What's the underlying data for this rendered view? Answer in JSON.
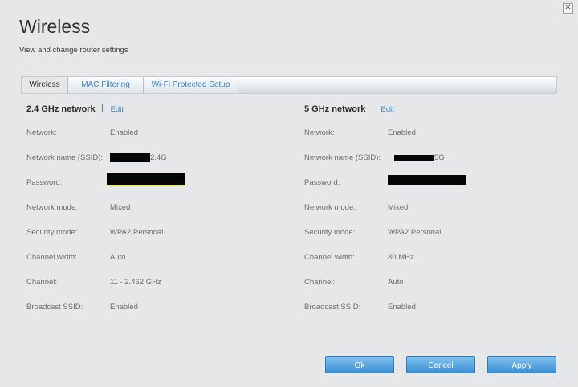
{
  "dialog": {
    "title": "Wireless",
    "subtitle": "View and change router settings",
    "close_glyph": "✕"
  },
  "tabs": [
    {
      "label": "Wireless",
      "active": true
    },
    {
      "label": "MAC Filtering",
      "active": false
    },
    {
      "label": "Wi-Fi Protected Setup",
      "active": false
    }
  ],
  "networks": {
    "band24": {
      "title": "2.4 GHz network",
      "edit_label": "Edit",
      "rows": [
        {
          "label": "Network:",
          "value": "Enabled"
        },
        {
          "label": "Network name (SSID):",
          "value": "2.4G"
        },
        {
          "label": "Password:",
          "value": ""
        },
        {
          "label": "Network mode:",
          "value": "Mixed"
        },
        {
          "label": "Security mode:",
          "value": "WPA2 Personal"
        },
        {
          "label": "Channel width:",
          "value": "Auto"
        },
        {
          "label": "Channel:",
          "value": "11 - 2.462 GHz"
        },
        {
          "label": "Broadcast SSID:",
          "value": "Enabled"
        }
      ]
    },
    "band5": {
      "title": "5 GHz network",
      "edit_label": "Edit",
      "rows": [
        {
          "label": "Network:",
          "value": "Enabled"
        },
        {
          "label": "Network name (SSID):",
          "value": "5G"
        },
        {
          "label": "Password:",
          "value": ""
        },
        {
          "label": "Network mode:",
          "value": "Mixed"
        },
        {
          "label": "Security mode:",
          "value": "WPA2 Personal"
        },
        {
          "label": "Channel width:",
          "value": "80 MHz"
        },
        {
          "label": "Channel:",
          "value": "Auto"
        },
        {
          "label": "Broadcast SSID:",
          "value": "Enabled"
        }
      ]
    }
  },
  "footer": {
    "ok_label": "Ok",
    "cancel_label": "Cancel",
    "apply_label": "Apply"
  },
  "colors": {
    "accent": "#3a83c8",
    "button": "#4a9ad9",
    "background": "#e6e7e8"
  }
}
